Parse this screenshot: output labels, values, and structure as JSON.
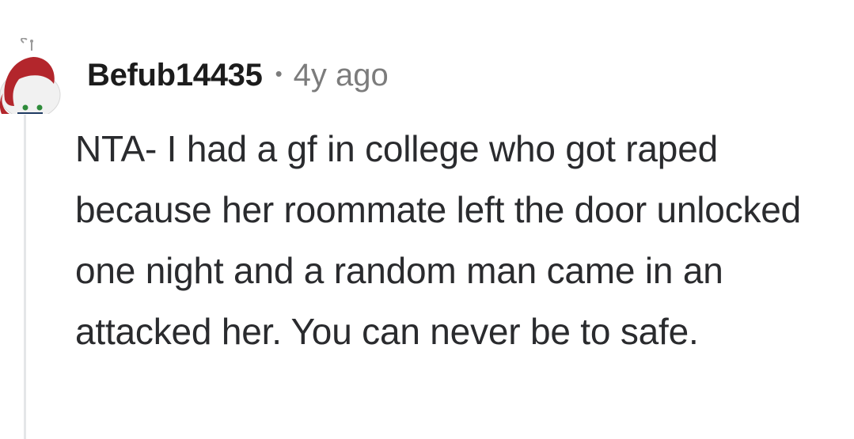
{
  "comment": {
    "author": "Befub14435",
    "separator": "•",
    "age": "4y ago",
    "body": "NTA- I had a gf in college who got raped because her roommate left the door unlocked one night and a random man came in an attacked her. You can never be to safe."
  },
  "colors": {
    "author": "#1c1c1c",
    "meta": "#7c7c7c",
    "body": "#2a2b2e",
    "thread_line": "#e4e6e8"
  },
  "icons": {
    "avatar": "user-avatar-icon"
  }
}
